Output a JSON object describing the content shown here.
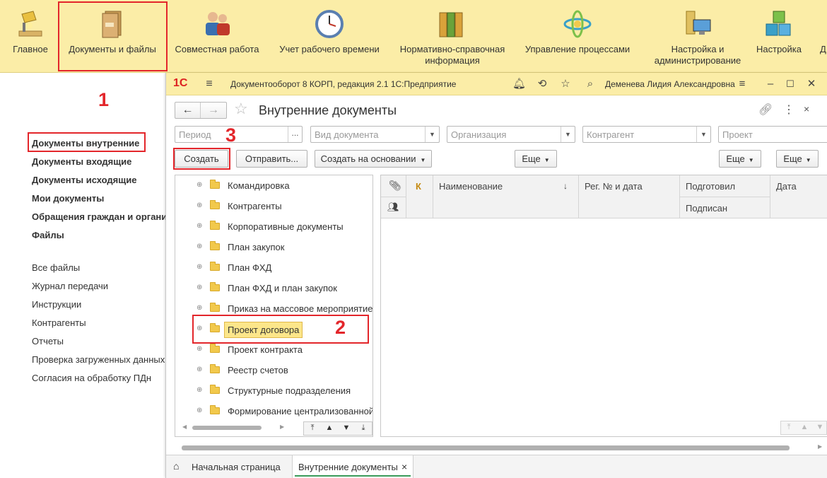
{
  "sections": [
    {
      "label": "Главное",
      "icon": "desk-lamp-icon"
    },
    {
      "label": "Документы и файлы",
      "icon": "folder-documents-icon"
    },
    {
      "label": "Совместная работа",
      "icon": "people-icon"
    },
    {
      "label": "Учет рабочего времени",
      "icon": "clock-icon"
    },
    {
      "label": "Нормативно-справочная информация",
      "icon": "binders-icon"
    },
    {
      "label": "Управление процессами",
      "icon": "process-icon"
    },
    {
      "label": "Настройка и администрирование",
      "icon": "computer-icon"
    },
    {
      "label": "Настройка",
      "icon": "cubes-icon"
    },
    {
      "label": "Д"
    }
  ],
  "left_menu": {
    "bold_items": [
      "Документы внутренние",
      "Документы входящие",
      "Документы исходящие",
      "Мои документы",
      "Обращения граждан и организаций",
      "Файлы"
    ],
    "items": [
      "Все файлы",
      "Журнал передачи",
      "Инструкции",
      "Контрагенты",
      "Отчеты",
      "Проверка загруженных данных",
      "Согласия на обработку ПДн"
    ]
  },
  "annotations": {
    "n1": "1",
    "n2": "2",
    "n3": "3"
  },
  "window": {
    "logo": "1С",
    "app_title": "Документооборот 8 КОРП, редакция 2.1 1С:Предприятие",
    "user": "Деменева Лидия Александровна",
    "form_title": "Внутренние документы",
    "filters": {
      "period": "Период",
      "period_btn": "...",
      "doc_type": "Вид документа",
      "org": "Организация",
      "counterparty": "Контрагент",
      "project": "Проект"
    },
    "buttons": {
      "create": "Создать",
      "send": "Отправить...",
      "create_based": "Создать на основании",
      "more1": "Еще",
      "more2": "Еще",
      "more3": "Еще"
    },
    "tree": [
      "Командировка",
      "Контрагенты",
      "Корпоративные документы",
      "План закупок",
      "План ФХД",
      "План ФХД и план закупок",
      "Приказ на массовое мероприятие",
      "Проект договора",
      "Проект контракта",
      "Реестр счетов",
      "Структурные подразделения",
      "Формирование централизованной"
    ],
    "selected_tree_item": "Проект договора",
    "grid_headers": {
      "k": "К",
      "name": "Наименование",
      "reg": "Рег. № и дата",
      "prepared": "Подготовил",
      "signed": "Подписан",
      "date": "Дата"
    },
    "tabs": {
      "home": "Начальная страница",
      "internal": "Внутренние документы",
      "close": "×"
    }
  },
  "colors": {
    "accent_yellow": "#fbeda7",
    "annotation_red": "#e3262b",
    "selected_item": "#fce68a"
  }
}
